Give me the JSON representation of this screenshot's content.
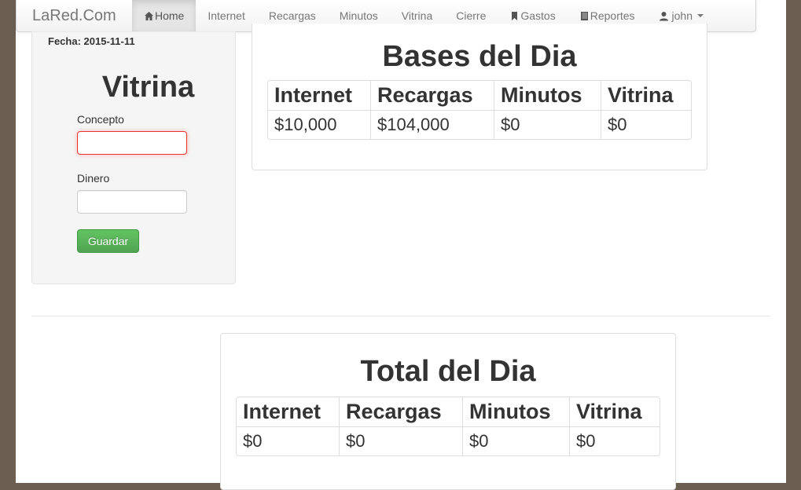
{
  "navbar": {
    "brand": "LaRed.Com",
    "items": [
      {
        "label": "Home",
        "icon": "home-icon"
      },
      {
        "label": "Internet"
      },
      {
        "label": "Recargas"
      },
      {
        "label": "Minutos"
      },
      {
        "label": "Vitrina"
      },
      {
        "label": "Cierre"
      },
      {
        "label": "Gastos",
        "icon": "bookmark-icon"
      },
      {
        "label": "Reportes",
        "icon": "book-icon"
      }
    ],
    "user": "john"
  },
  "sidebar": {
    "fecha_label": "Fecha:",
    "fecha_value": "2015-11-11",
    "title": "Vitrina",
    "concepto_label": "Concepto",
    "concepto_value": "",
    "dinero_label": "Dinero",
    "dinero_value": "",
    "save_label": "Guardar"
  },
  "bases": {
    "title": "Bases del Dia",
    "headers": [
      "Internet",
      "Recargas",
      "Minutos",
      "Vitrina"
    ],
    "values": [
      "$10,000",
      "$104,000",
      "$0",
      "$0"
    ]
  },
  "totales": {
    "title": "Total del Dia",
    "headers": [
      "Internet",
      "Recargas",
      "Minutos",
      "Vitrina"
    ],
    "values": [
      "$0",
      "$0",
      "$0",
      "$0"
    ]
  },
  "colors": {
    "background": "#6b5f52",
    "success": "#5bb75b",
    "focus_border": "#e9322d"
  }
}
